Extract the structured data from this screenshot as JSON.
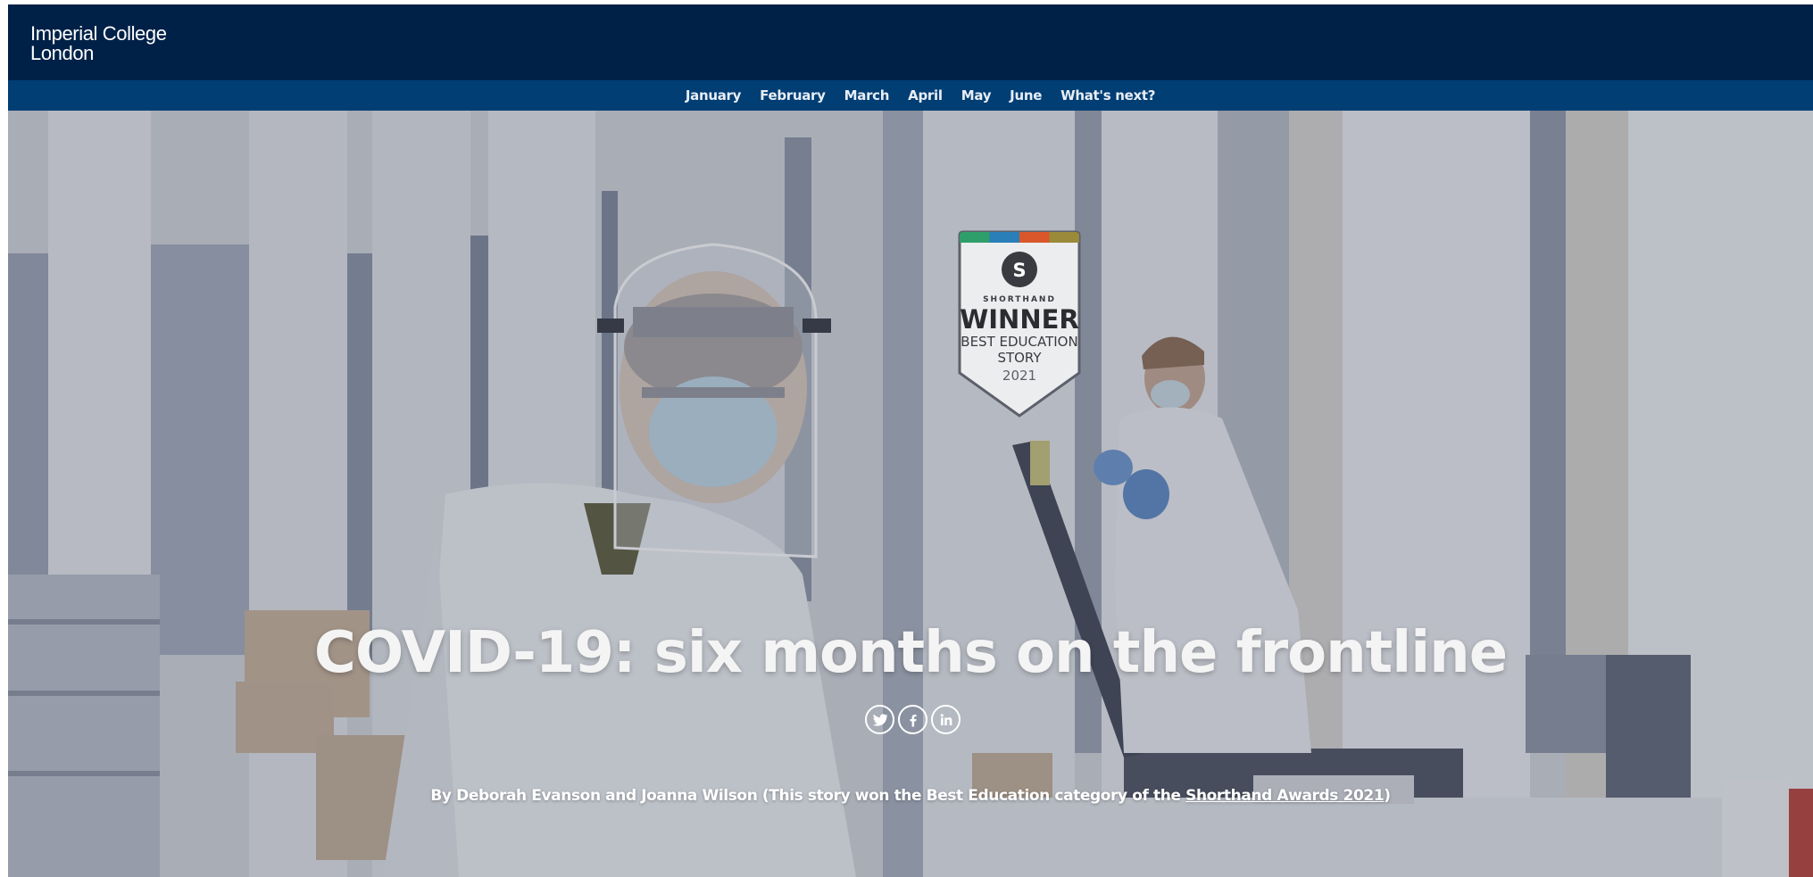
{
  "header": {
    "logo_line1": "Imperial College",
    "logo_line2": "London"
  },
  "nav": {
    "items": [
      {
        "label": "January"
      },
      {
        "label": "February"
      },
      {
        "label": "March"
      },
      {
        "label": "April"
      },
      {
        "label": "May"
      },
      {
        "label": "June"
      },
      {
        "label": "What's next?"
      }
    ]
  },
  "hero": {
    "title": "COVID-19: six months on the frontline",
    "byline_text": "By Deborah Evanson and Joanna Wilson (This story won the Best Education category of the ",
    "byline_link": "Shorthand Awards 2021",
    "byline_end": ")",
    "share_icons": [
      "twitter-icon",
      "facebook-icon",
      "linkedin-icon"
    ]
  },
  "badge": {
    "logo_letter": "S",
    "brand": "SHORTHAND",
    "line1": "WINNER",
    "line2": "BEST EDUCATION",
    "line3": "STORY",
    "year": "2021",
    "stripe_colors": [
      "#2e9e6a",
      "#2a7fb8",
      "#d9572b",
      "#9a8a3a"
    ]
  },
  "colors": {
    "header_bg": "#002147",
    "nav_bg": "#003e74"
  }
}
